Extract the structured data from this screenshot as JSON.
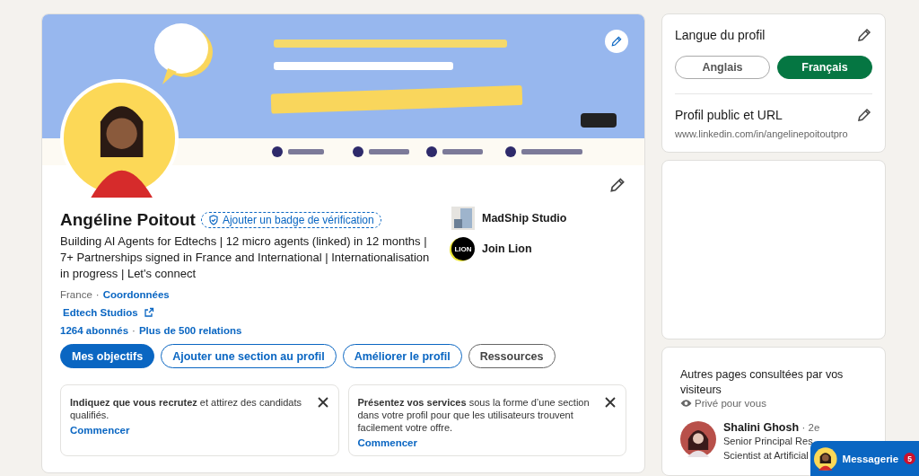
{
  "profile": {
    "name": "Angéline Poitout",
    "verify_badge": "Ajouter un badge de vérification",
    "headline": "Building AI Agents for Edtechs | 12 micro agents (linked) in 12 months | 7+ Partnerships signed in France and International | Internationalisation in progress | Let's connect",
    "location": "France",
    "location_separator": "·",
    "stats_separator": "·",
    "contact_link": "Coordonnées",
    "website": "Edtech Studios",
    "followers": "1264 abonnés",
    "connections": "Plus de 500 relations",
    "companies": [
      {
        "kind": "studio",
        "name": "MadShip Studio"
      },
      {
        "kind": "lion",
        "name": "Join Lion",
        "logo_text": "LION"
      }
    ],
    "actions": [
      {
        "kind": "primary",
        "label": "Mes objectifs"
      },
      {
        "kind": "outline",
        "label": "Ajouter une section au profil"
      },
      {
        "kind": "outline",
        "label": "Améliorer le profil"
      },
      {
        "kind": "neutral",
        "label": "Ressources"
      }
    ],
    "suggestions": [
      {
        "text": "**Indiquez que vous recrutez** et attirez des candidats qualifiés.",
        "action": "Commencer"
      },
      {
        "text": "**Présentez vos services** sous la forme d’une section dans votre profil pour que les utilisateurs trouvent facilement votre offre.",
        "action": "Commencer"
      }
    ]
  },
  "language": {
    "title": "Langue du profil",
    "options": [
      {
        "label": "Anglais",
        "selected": false
      },
      {
        "label": "Français",
        "selected": true
      }
    ]
  },
  "public_profile": {
    "title": "Profil public et URL",
    "url": "www.linkedin.com/in/angelinepoitoutpro"
  },
  "visitors": {
    "title": "Autres pages consultées par vos visiteurs",
    "privacy": "Privé pour vous",
    "people": [
      {
        "name": "Shalini Ghosh",
        "degree": "· 2e",
        "headline_lines": [
          "Senior Principal Res",
          "Scientist at Artificial"
        ]
      }
    ]
  },
  "messaging": {
    "label": "Messagerie",
    "count": "5"
  }
}
